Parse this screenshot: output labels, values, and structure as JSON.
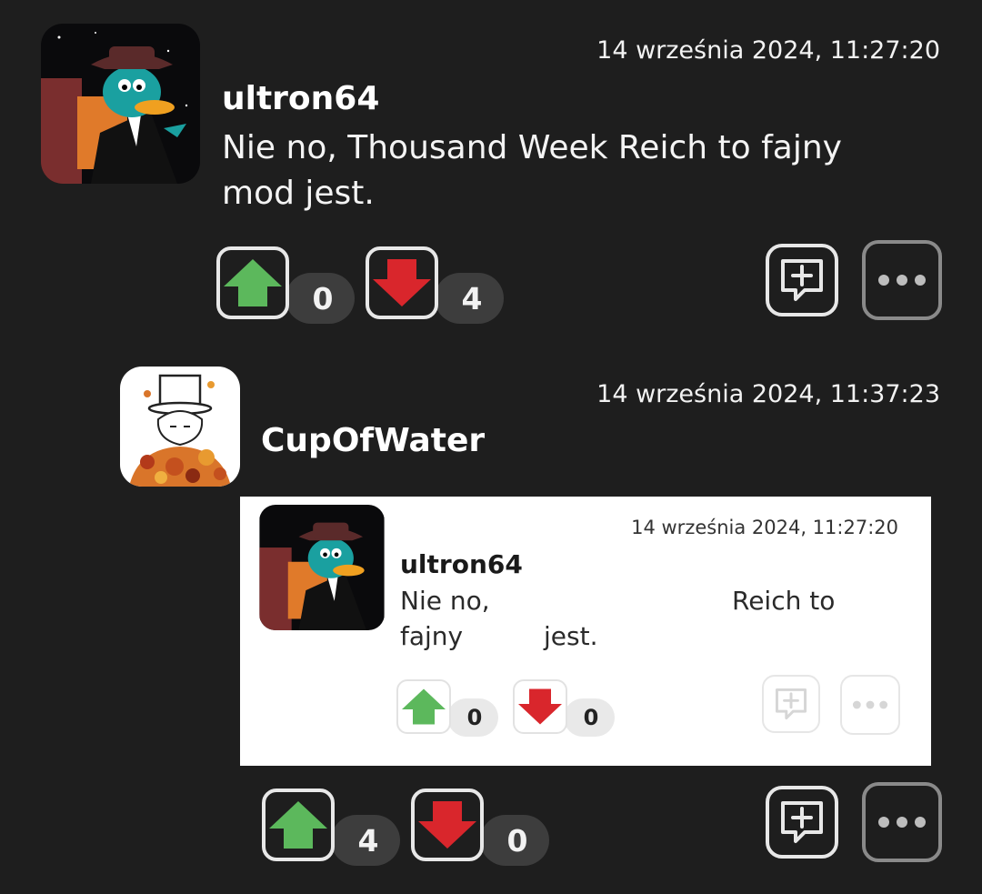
{
  "comments": [
    {
      "avatar_icon": "perry-fedora-avatar-icon",
      "timestamp": "14 września 2024, 11:27:20",
      "username": "ultron64",
      "text_lines": [
        "Nie no, Thousand Week Reich to fajny",
        "mod jest."
      ],
      "upvotes": "0",
      "downvotes": "4"
    },
    {
      "avatar_icon": "top-hat-leaves-avatar-icon",
      "timestamp": "14 września 2024, 11:37:23",
      "username": "CupOfWater",
      "embedded": {
        "timestamp": "14 września 2024, 11:27:20",
        "username": "ultron64",
        "line1_left": "Nie no,",
        "line1_right": "Reich to",
        "line2_left": "fajny",
        "line2_right": "jest.",
        "upvotes": "0",
        "downvotes": "0"
      },
      "upvotes": "4",
      "downvotes": "0"
    }
  ],
  "colors": {
    "background": "#1e1e1e",
    "upvote": "#5cb85c",
    "downvote": "#d9262c",
    "pill": "#3d3d3d"
  },
  "icons": {
    "upvote": "arrow-up-icon",
    "downvote": "arrow-down-icon",
    "reply": "reply-plus-icon",
    "more": "ellipsis-icon"
  }
}
